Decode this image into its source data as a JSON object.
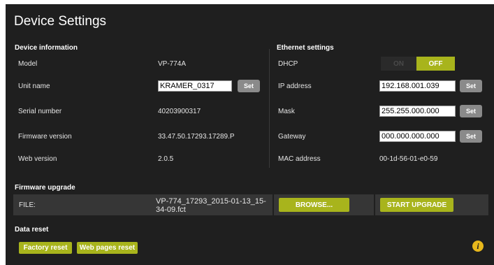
{
  "title": "Device Settings",
  "device_info": {
    "heading": "Device information",
    "model_label": "Model",
    "model_value": "VP-774A",
    "unit_name_label": "Unit name",
    "unit_name_value": "KRAMER_0317",
    "serial_label": "Serial number",
    "serial_value": "40203900317",
    "firmware_label": "Firmware version",
    "firmware_value": "33.47.50.17293.17289.P",
    "web_label": "Web version",
    "web_value": "2.0.5"
  },
  "ethernet": {
    "heading": "Ethernet settings",
    "dhcp_label": "DHCP",
    "dhcp_on": "ON",
    "dhcp_off": "OFF",
    "dhcp_state": "OFF",
    "ip_label": "IP address",
    "ip_value": "192.168.001.039",
    "mask_label": "Mask",
    "mask_value": "255.255.000.000",
    "gateway_label": "Gateway",
    "gateway_value": "000.000.000.000",
    "mac_label": "MAC address",
    "mac_value": "00-1d-56-01-e0-59"
  },
  "set_label": "Set",
  "firmware_upgrade": {
    "heading": "Firmware upgrade",
    "file_label": "FILE:",
    "file_name": "VP-774_17293_2015-01-13_15-34-09.fct",
    "browse_label": "BROWSE...",
    "start_label": "START UPGRADE"
  },
  "data_reset": {
    "heading": "Data reset",
    "factory_reset_label": "Factory reset",
    "web_pages_reset_label": "Web pages reset"
  },
  "info_icon": "info-icon",
  "colors": {
    "panel_bg": "#1f1f1f",
    "accent": "#a8b41c",
    "set_button": "#8a8a8a",
    "info": "#e8b81c"
  }
}
